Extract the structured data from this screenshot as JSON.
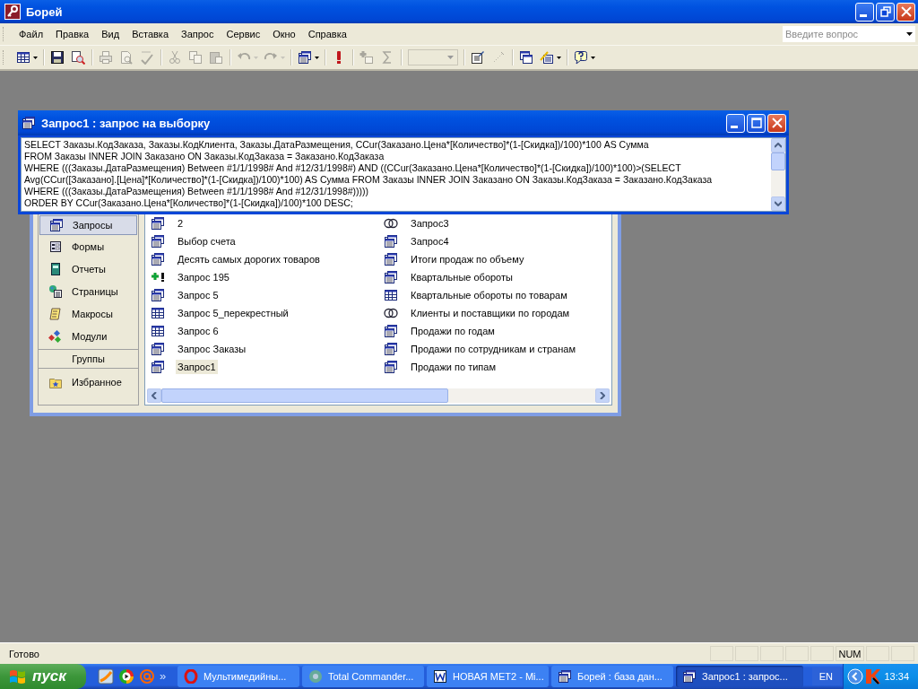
{
  "window": {
    "title": "Борей"
  },
  "menu": [
    {
      "label": "Файл"
    },
    {
      "label": "Правка"
    },
    {
      "label": "Вид"
    },
    {
      "label": "Вставка"
    },
    {
      "label": "Запрос"
    },
    {
      "label": "Сервис"
    },
    {
      "label": "Окно"
    },
    {
      "label": "Справка"
    }
  ],
  "question_box": {
    "placeholder": "Введите вопрос"
  },
  "toolbar": [
    {
      "kind": "datasheet",
      "disabled": false,
      "dropdown": true
    },
    {
      "kind": "separator"
    },
    {
      "kind": "save",
      "disabled": false
    },
    {
      "kind": "search",
      "disabled": false
    },
    {
      "kind": "separator"
    },
    {
      "kind": "print",
      "disabled": true
    },
    {
      "kind": "preview",
      "disabled": true
    },
    {
      "kind": "spelling",
      "disabled": true
    },
    {
      "kind": "separator"
    },
    {
      "kind": "cut",
      "disabled": true
    },
    {
      "kind": "copy",
      "disabled": true
    },
    {
      "kind": "paste",
      "disabled": true
    },
    {
      "kind": "separator"
    },
    {
      "kind": "undo",
      "disabled": true,
      "dropdown": true
    },
    {
      "kind": "redo",
      "disabled": true,
      "dropdown": true
    },
    {
      "kind": "separator"
    },
    {
      "kind": "query_type",
      "disabled": false,
      "dropdown": true
    },
    {
      "kind": "separator"
    },
    {
      "kind": "run",
      "disabled": false
    },
    {
      "kind": "separator"
    },
    {
      "kind": "show_table",
      "disabled": true
    },
    {
      "kind": "totals",
      "disabled": true
    },
    {
      "kind": "separator"
    },
    {
      "kind": "combo",
      "disabled": true
    },
    {
      "kind": "separator"
    },
    {
      "kind": "properties",
      "disabled": false
    },
    {
      "kind": "build",
      "disabled": true
    },
    {
      "kind": "separator"
    },
    {
      "kind": "database_window",
      "disabled": false
    },
    {
      "kind": "new_object",
      "disabled": false,
      "dropdown": true
    },
    {
      "kind": "separator"
    },
    {
      "kind": "help",
      "disabled": false,
      "dropdown": true
    }
  ],
  "query_window": {
    "title": "Запрос1 : запрос на выборку",
    "sql_lines": [
      "SELECT Заказы.КодЗаказа, Заказы.КодКлиента, Заказы.ДатаРазмещения, CCur(Заказано.Цена*[Количество]*(1-[Скидка])/100)*100 AS Сумма",
      "FROM Заказы INNER JOIN Заказано ON Заказы.КодЗаказа = Заказано.КодЗаказа",
      "WHERE (((Заказы.ДатаРазмещения) Between #1/1/1998# And #12/31/1998#) AND ((CCur(Заказано.Цена*[Количество]*(1-[Скидка])/100)*100)>(SELECT",
      "Avg(CCur([Заказано].[Цена]*[Количество]*(1-[Скидка])/100)*100) AS Сумма FROM Заказы INNER JOIN Заказано ON Заказы.КодЗаказа = Заказано.КодЗаказа",
      "WHERE (((Заказы.ДатаРазмещения) Between #1/1/1998# And #12/31/1998#)))))",
      "ORDER BY CCur(Заказано.Цена*[Количество]*(1-[Скидка])/100)*100 DESC;"
    ]
  },
  "database_window": {
    "sidebar": [
      {
        "kind": "queries",
        "label": "Запросы",
        "selected": true
      },
      {
        "kind": "forms",
        "label": "Формы",
        "selected": false
      },
      {
        "kind": "reports",
        "label": "Отчеты",
        "selected": false
      },
      {
        "kind": "pages",
        "label": "Страницы",
        "selected": false
      },
      {
        "kind": "macros",
        "label": "Макросы",
        "selected": false
      },
      {
        "kind": "modules",
        "label": "Модули",
        "selected": false
      }
    ],
    "groups_header": "Группы",
    "groups": [
      {
        "kind": "favorites",
        "label": "Избранное",
        "selected": false
      }
    ],
    "objects": [
      {
        "kind": "select",
        "label": "2",
        "selected": false
      },
      {
        "kind": "select",
        "label": "Выбор счета",
        "selected": false
      },
      {
        "kind": "select",
        "label": "Десять самых дорогих товаров",
        "selected": false
      },
      {
        "kind": "append",
        "label": "Запрос 195",
        "selected": false
      },
      {
        "kind": "select",
        "label": "Запрос 5",
        "selected": false
      },
      {
        "kind": "crosstab",
        "label": "Запрос 5_перекрестный",
        "selected": false
      },
      {
        "kind": "crosstab",
        "label": "Запрос 6",
        "selected": false
      },
      {
        "kind": "select",
        "label": "Запрос Заказы",
        "selected": false
      },
      {
        "kind": "select",
        "label": "Запрос1",
        "selected": true
      },
      {
        "kind": "union",
        "label": "Запрос3",
        "selected": false
      },
      {
        "kind": "select",
        "label": "Запрос4",
        "selected": false
      },
      {
        "kind": "select",
        "label": "Итоги продаж по объему",
        "selected": false
      },
      {
        "kind": "select",
        "label": "Квартальные обороты",
        "selected": false
      },
      {
        "kind": "crosstab",
        "label": "Квартальные обороты по товарам",
        "selected": false
      },
      {
        "kind": "union",
        "label": "Клиенты и поставщики по городам",
        "selected": false
      },
      {
        "kind": "select",
        "label": "Продажи по годам",
        "selected": false
      },
      {
        "kind": "select",
        "label": "Продажи по сотрудникам и странам",
        "selected": false
      },
      {
        "kind": "select",
        "label": "Продажи по типам",
        "selected": false
      }
    ]
  },
  "status_bar": {
    "text": "Готово",
    "indicator": "NUM"
  },
  "taskbar": {
    "start_label": "пуск",
    "quick_launch": [
      {
        "kind": "chart"
      },
      {
        "kind": "media"
      },
      {
        "kind": "at"
      }
    ],
    "more": "»",
    "tasks": [
      {
        "kind": "opera",
        "label": "Мультимедийны...",
        "selected": false
      },
      {
        "kind": "commander",
        "label": "Total Commander...",
        "selected": false
      },
      {
        "kind": "word",
        "label": "НОВАЯ МЕТ2 - Mi...",
        "selected": false
      },
      {
        "kind": "database",
        "label": "Борей : база дан...",
        "selected": false
      },
      {
        "kind": "query",
        "label": "Запрос1 : запрос...",
        "selected": true
      }
    ],
    "language": "EN",
    "clock": "13:34"
  }
}
